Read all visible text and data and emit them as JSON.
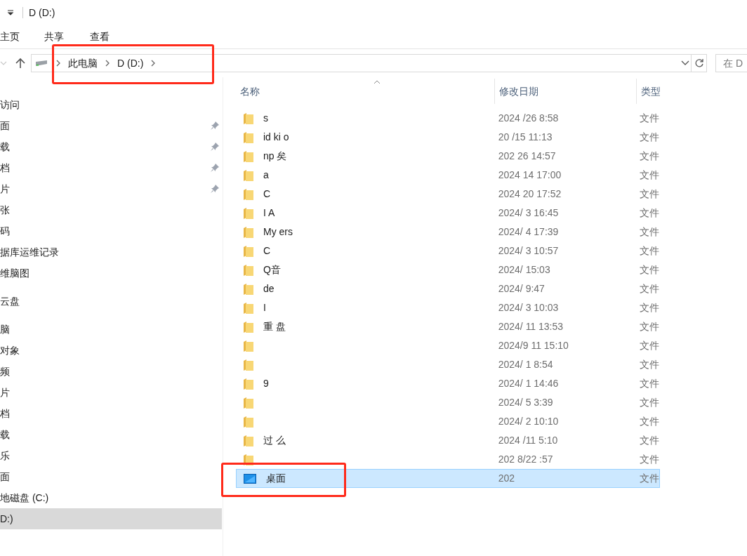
{
  "window": {
    "title": "D (D:)"
  },
  "ribbon_tabs": [
    {
      "label": "主页",
      "selected": false
    },
    {
      "label": "共享",
      "selected": false
    },
    {
      "label": "查看",
      "selected": false
    }
  ],
  "address_bar": {
    "crumbs": [
      "此电脑",
      "D (D:)"
    ],
    "search_placeholder": "在 D"
  },
  "sidebar": {
    "groups": [
      {
        "items": [
          {
            "label": "访问",
            "pinned": false,
            "selected": false
          },
          {
            "label": "面",
            "pinned": true,
            "selected": false
          },
          {
            "label": "载",
            "pinned": true,
            "selected": false
          },
          {
            "label": "档",
            "pinned": true,
            "selected": false
          },
          {
            "label": "片",
            "pinned": true,
            "selected": false
          },
          {
            "label": "张",
            "pinned": false,
            "selected": false
          },
          {
            "label": "码",
            "pinned": false,
            "selected": false
          },
          {
            "label": "据库运维记录",
            "pinned": false,
            "selected": false
          },
          {
            "label": "维脑图",
            "pinned": false,
            "selected": false
          }
        ]
      },
      {
        "items": [
          {
            "label": "云盘",
            "pinned": false,
            "selected": false
          }
        ]
      },
      {
        "items": [
          {
            "label": "脑",
            "pinned": false,
            "selected": false
          },
          {
            "label": "对象",
            "pinned": false,
            "selected": false
          },
          {
            "label": "频",
            "pinned": false,
            "selected": false
          },
          {
            "label": "片",
            "pinned": false,
            "selected": false
          },
          {
            "label": "档",
            "pinned": false,
            "selected": false
          },
          {
            "label": "载",
            "pinned": false,
            "selected": false
          },
          {
            "label": "乐",
            "pinned": false,
            "selected": false
          },
          {
            "label": "面",
            "pinned": false,
            "selected": false
          },
          {
            "label": "地磁盘 (C:)",
            "pinned": false,
            "selected": false
          },
          {
            "label": "D:)",
            "pinned": false,
            "selected": true
          }
        ]
      }
    ]
  },
  "table": {
    "columns": [
      "名称",
      "修改日期",
      "类型"
    ],
    "rows": [
      {
        "kind": "folder",
        "name": "s",
        "date": "2024 /26 8:58",
        "type": "文件",
        "selected": false
      },
      {
        "kind": "folder",
        "name": "id ki o",
        "date": "20 /15 11:13",
        "type": "文件",
        "selected": false
      },
      {
        "kind": "folder",
        "name": "np 矣",
        "date": "202 26 14:57",
        "type": "文件",
        "selected": false
      },
      {
        "kind": "folder",
        "name": "a",
        "date": "2024 14 17:00",
        "type": "文件",
        "selected": false
      },
      {
        "kind": "folder",
        "name": "C",
        "date": "2024 20 17:52",
        "type": "文件",
        "selected": false
      },
      {
        "kind": "folder",
        "name": "I A",
        "date": "2024/ 3 16:45",
        "type": "文件",
        "selected": false
      },
      {
        "kind": "folder",
        "name": "My ers",
        "date": "2024/ 4 17:39",
        "type": "文件",
        "selected": false
      },
      {
        "kind": "folder",
        "name": "C",
        "date": "2024/ 3 10:57",
        "type": "文件",
        "selected": false
      },
      {
        "kind": "folder",
        "name": "Q音",
        "date": "2024/ 15:03",
        "type": "文件",
        "selected": false
      },
      {
        "kind": "folder",
        "name": "de",
        "date": "2024/ 9:47",
        "type": "文件",
        "selected": false
      },
      {
        "kind": "folder",
        "name": "I",
        "date": "2024/ 3 10:03",
        "type": "文件",
        "selected": false
      },
      {
        "kind": "folder",
        "name": "重 盘",
        "date": "2024/ 11 13:53",
        "type": "文件",
        "selected": false
      },
      {
        "kind": "folder",
        "date": "2024/9 11 15:10",
        "type": "文件",
        "selected": false
      },
      {
        "kind": "folder",
        "date": "2024/ 1 8:54",
        "type": "文件",
        "selected": false
      },
      {
        "kind": "folder",
        "name": "9",
        "date": "2024/ 1 14:46",
        "type": "文件",
        "selected": false
      },
      {
        "kind": "folder",
        "date": "2024/ 5 3:39",
        "type": "文件",
        "selected": false
      },
      {
        "kind": "folder",
        "date": "2024/ 2 10:10",
        "type": "文件",
        "selected": false
      },
      {
        "kind": "folder",
        "name": "过 么",
        "date": "2024 /11 5:10",
        "type": "文件",
        "selected": false
      },
      {
        "kind": "folder",
        "date": "202 8/22 :57",
        "type": "文件",
        "selected": false
      },
      {
        "kind": "desktop",
        "name": "桌面",
        "date": "202",
        "type": "文件",
        "selected": true
      }
    ]
  }
}
